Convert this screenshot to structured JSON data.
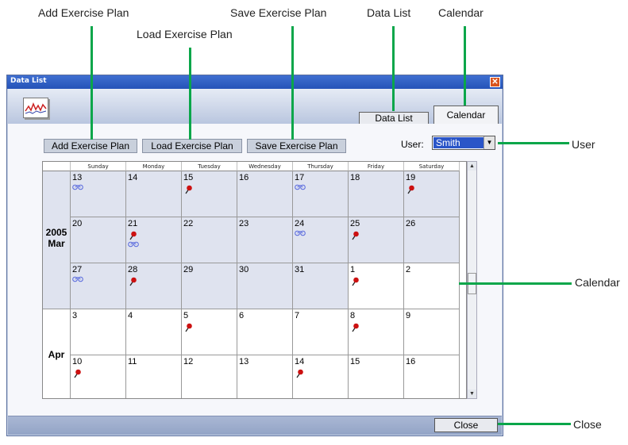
{
  "callouts": {
    "add": "Add Exercise Plan",
    "load": "Load Exercise Plan",
    "save": "Save Exercise Plan",
    "datalist": "Data List",
    "calendar": "Calendar",
    "user": "User",
    "calendar_area": "Calendar",
    "close": "Close"
  },
  "window": {
    "title": "Data List",
    "close_glyph": "✕"
  },
  "tabs": {
    "data_list": "Data List",
    "calendar": "Calendar"
  },
  "toolbar": {
    "add": "Add Exercise Plan",
    "load": "Load Exercise Plan",
    "save": "Save Exercise Plan",
    "user_label": "User:",
    "user_value": "Smith",
    "user_arrow": "▼"
  },
  "calendar": {
    "days": [
      "Sunday",
      "Monday",
      "Tuesday",
      "Wednesday",
      "Thursday",
      "Friday",
      "Saturday"
    ],
    "year": "2005",
    "month1": "Mar",
    "month2": "Apr",
    "weeks": [
      [
        {
          "d": "13",
          "bike": true
        },
        {
          "d": "14"
        },
        {
          "d": "15",
          "pin": true
        },
        {
          "d": "16"
        },
        {
          "d": "17",
          "bike": true
        },
        {
          "d": "18"
        },
        {
          "d": "19",
          "pin": true
        }
      ],
      [
        {
          "d": "20"
        },
        {
          "d": "21",
          "pin": true,
          "bike": true
        },
        {
          "d": "22"
        },
        {
          "d": "23"
        },
        {
          "d": "24",
          "bike": true
        },
        {
          "d": "25",
          "pin": true
        },
        {
          "d": "26"
        }
      ],
      [
        {
          "d": "27",
          "bike": true
        },
        {
          "d": "28",
          "pin": true
        },
        {
          "d": "29"
        },
        {
          "d": "30"
        },
        {
          "d": "31"
        },
        {
          "d": "1",
          "pin": true
        },
        {
          "d": "2"
        }
      ],
      [
        {
          "d": "3"
        },
        {
          "d": "4"
        },
        {
          "d": "5",
          "pin": true
        },
        {
          "d": "6"
        },
        {
          "d": "7"
        },
        {
          "d": "8",
          "pin": true
        },
        {
          "d": "9"
        }
      ],
      [
        {
          "d": "10",
          "pin": true
        },
        {
          "d": "11"
        },
        {
          "d": "12"
        },
        {
          "d": "13"
        },
        {
          "d": "14",
          "pin": true
        },
        {
          "d": "15"
        },
        {
          "d": "16"
        }
      ]
    ],
    "scroll_up": "▲",
    "scroll_down": "▼"
  },
  "footer": {
    "close": "Close"
  },
  "colors": {
    "accent": "#0aa64a",
    "march_bg": "#dfe3ef",
    "pin": "#cc1111"
  }
}
